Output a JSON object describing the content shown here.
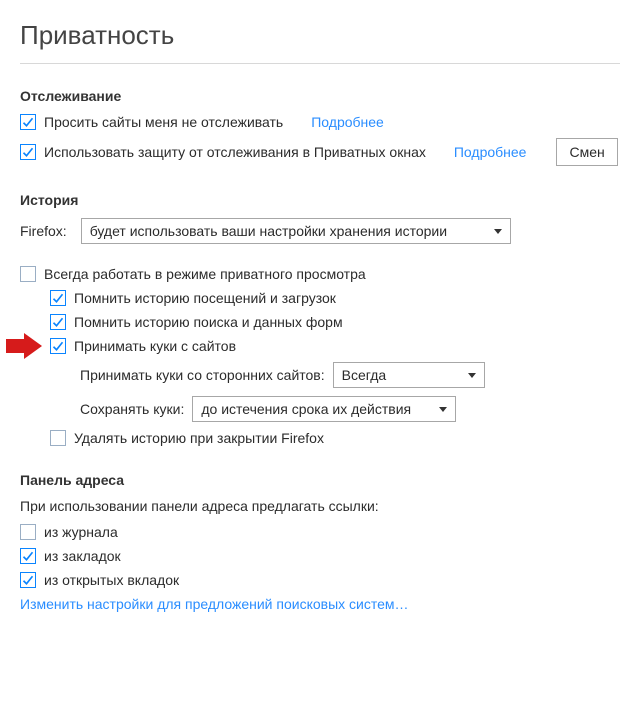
{
  "title": "Приватность",
  "tracking": {
    "heading": "Отслеживание",
    "doNotTrack": {
      "label": "Просить сайты меня не отслеживать",
      "checked": true,
      "more": "Подробнее"
    },
    "trackingProtection": {
      "label": "Использовать защиту от отслеживания в Приватных окнах",
      "checked": true,
      "more": "Подробнее",
      "change": "Смен"
    }
  },
  "history": {
    "heading": "История",
    "modeLabel": "Firefox:",
    "modeValue": "будет использовать ваши настройки хранения истории",
    "alwaysPrivate": {
      "label": "Всегда работать в режиме приватного просмотра",
      "checked": false
    },
    "rememberBrowsing": {
      "label": "Помнить историю посещений и загрузок",
      "checked": true
    },
    "rememberForms": {
      "label": "Помнить историю поиска и данных форм",
      "checked": true
    },
    "acceptCookies": {
      "label": "Принимать куки с сайтов",
      "checked": true
    },
    "thirdPartyLabel": "Принимать куки со сторонних сайтов:",
    "thirdPartyValue": "Всегда",
    "keepLabel": "Сохранять куки:",
    "keepValue": "до истечения срока их действия",
    "clearOnClose": {
      "label": "Удалять историю при закрытии Firefox",
      "checked": false
    }
  },
  "addressbar": {
    "heading": "Панель адреса",
    "description": "При использовании панели адреса предлагать ссылки:",
    "history": {
      "label": "из журнала",
      "checked": false
    },
    "bookmarks": {
      "label": "из закладок",
      "checked": true
    },
    "openTabs": {
      "label": "из открытых вкладок",
      "checked": true
    },
    "changeSearch": "Изменить настройки для предложений поисковых систем…"
  }
}
